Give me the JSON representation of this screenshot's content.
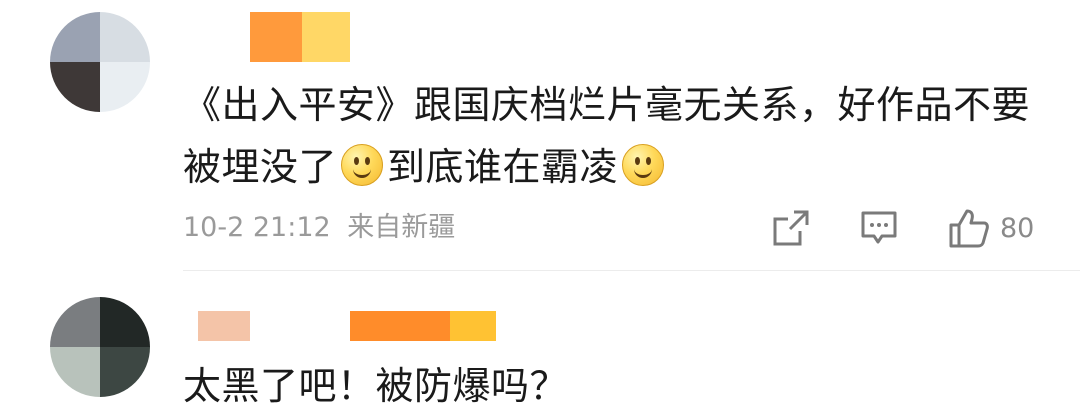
{
  "comments": [
    {
      "text_before_emoji1": "《出入平安》跟国庆档烂片毫无关系，好作品不要被埋没了",
      "text_between": "到底谁在霸凌",
      "emoji": "smile-emoji",
      "time": "10-2 21:12",
      "location": "来自新疆",
      "icons": [
        "share-icon",
        "comment-icon",
        "thumbs-up-icon"
      ],
      "likes": "80"
    },
    {
      "text": "太黑了吧！被防爆吗？"
    }
  ],
  "colors": {
    "text": "#1a1a1a",
    "meta": "#9a9a9a",
    "icon": "#7a7a7a",
    "nick1": [
      "#ff9a3c",
      "#ffd766"
    ],
    "nick2": [
      "#f4c4a8",
      "#ff8c2a",
      "#ffc233"
    ]
  }
}
